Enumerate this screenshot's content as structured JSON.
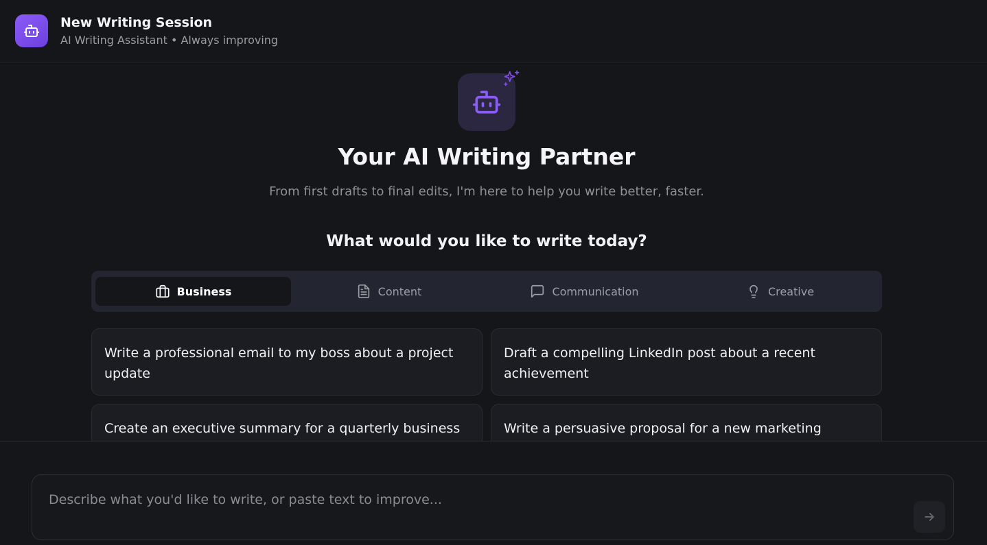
{
  "header": {
    "title": "New Writing Session",
    "subtitle": "AI Writing Assistant • Always improving",
    "avatar_icon": "robot-icon"
  },
  "hero": {
    "icon": "robot-icon",
    "badge_icon": "sparkles-icon",
    "title": "Your AI Writing Partner",
    "subtitle": "From first drafts to final edits, I'm here to help you write better, faster."
  },
  "prompt_heading": "What would you like to write today?",
  "tabs": [
    {
      "label": "Business",
      "icon": "briefcase-icon",
      "active": true
    },
    {
      "label": "Content",
      "icon": "document-icon",
      "active": false
    },
    {
      "label": "Communication",
      "icon": "chat-bubble-icon",
      "active": false
    },
    {
      "label": "Creative",
      "icon": "lightbulb-icon",
      "active": false
    }
  ],
  "suggestions": [
    {
      "text": "Write a professional email to my boss about a project update"
    },
    {
      "text": "Draft a compelling LinkedIn post about a recent achievement"
    },
    {
      "text": "Create an executive summary for a quarterly business"
    },
    {
      "text": "Write a persuasive proposal for a new marketing"
    }
  ],
  "composer": {
    "placeholder": "Describe what you'd like to write, or paste text to improve...",
    "value": "",
    "send_icon": "arrow-right-icon"
  },
  "colors": {
    "accent": "#8b5cf6",
    "background": "#151619",
    "tab_bar": "#232630"
  }
}
